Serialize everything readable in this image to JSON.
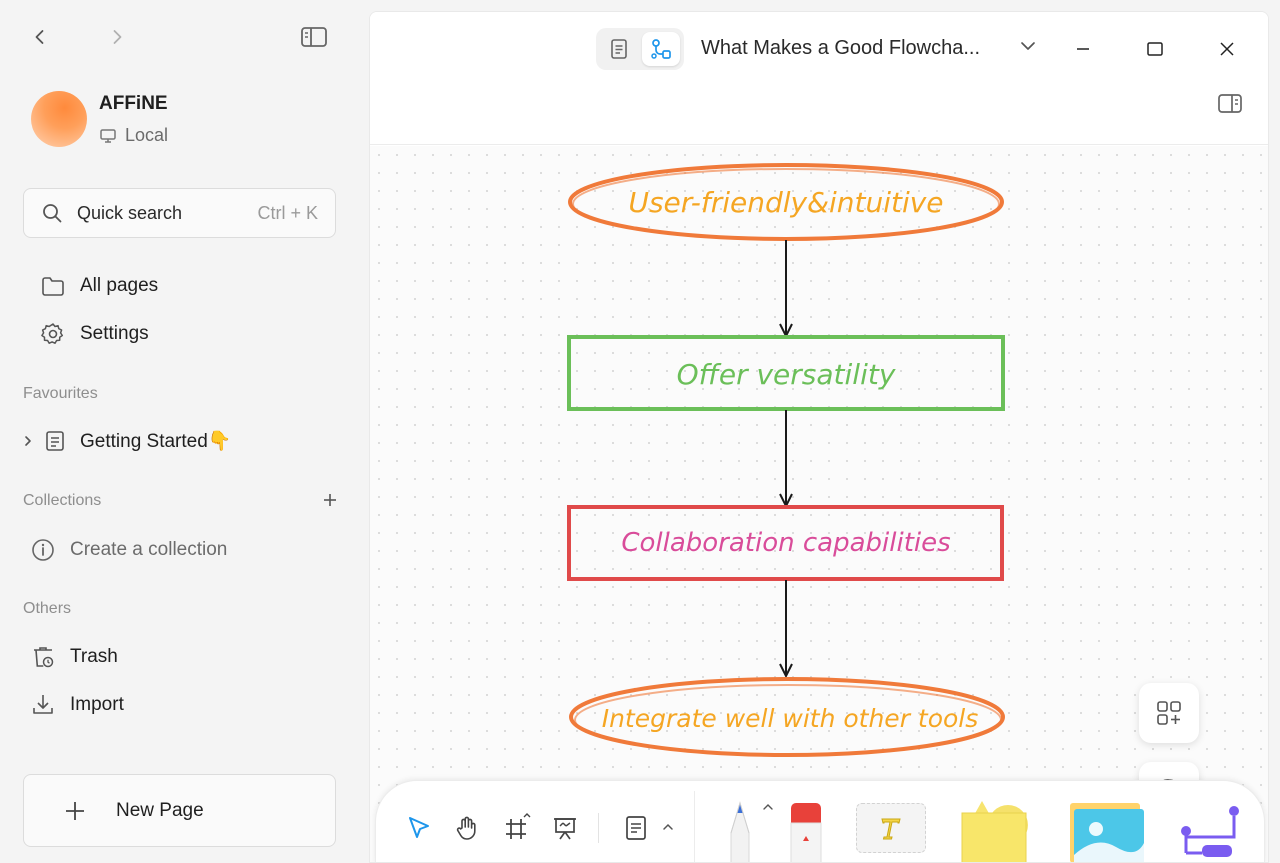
{
  "sidebar": {
    "workspace_name": "AFFiNE",
    "workspace_type": "Local",
    "search_label": "Quick search",
    "search_shortcut": "Ctrl + K",
    "nav": {
      "all_pages": "All pages",
      "settings": "Settings"
    },
    "favourites_title": "Favourites",
    "favourites": [
      {
        "label": "Getting Started",
        "emoji": "👇"
      }
    ],
    "collections_title": "Collections",
    "create_collection": "Create a collection",
    "others_title": "Others",
    "trash": "Trash",
    "import": "Import",
    "new_page": "New Page"
  },
  "header": {
    "doc_title": "What Makes a Good Flowcha..."
  },
  "canvas": {
    "nodes": [
      {
        "text": "User-friendly&intuitive",
        "shape": "ellipse",
        "stroke": "#f07a3a",
        "text_color": "#f5a623"
      },
      {
        "text": "Offer versatility",
        "shape": "rect",
        "stroke": "#6bbf59",
        "text_color": "#6bbf59"
      },
      {
        "text": "Collaboration capabilities",
        "shape": "rect",
        "stroke": "#e04a4a",
        "text_color": "#d94c9a"
      },
      {
        "text": "Integrate well with other tools",
        "shape": "ellipse",
        "stroke": "#f07a3a",
        "text_color": "#f5a623"
      }
    ]
  },
  "colors": {
    "accent": "#1e96eb",
    "sidebar_bg": "#f4f4f4",
    "main_bg": "#ffffff"
  },
  "icons": {
    "back": "chevron-left-icon",
    "forward": "chevron-right-icon",
    "sidebar_toggle": "sidebar-toggle-icon",
    "search": "search-icon",
    "folder": "folder-icon",
    "settings": "gear-icon",
    "page": "page-icon",
    "info": "info-icon",
    "trash": "trash-icon",
    "import": "download-icon",
    "plus": "plus-icon"
  }
}
